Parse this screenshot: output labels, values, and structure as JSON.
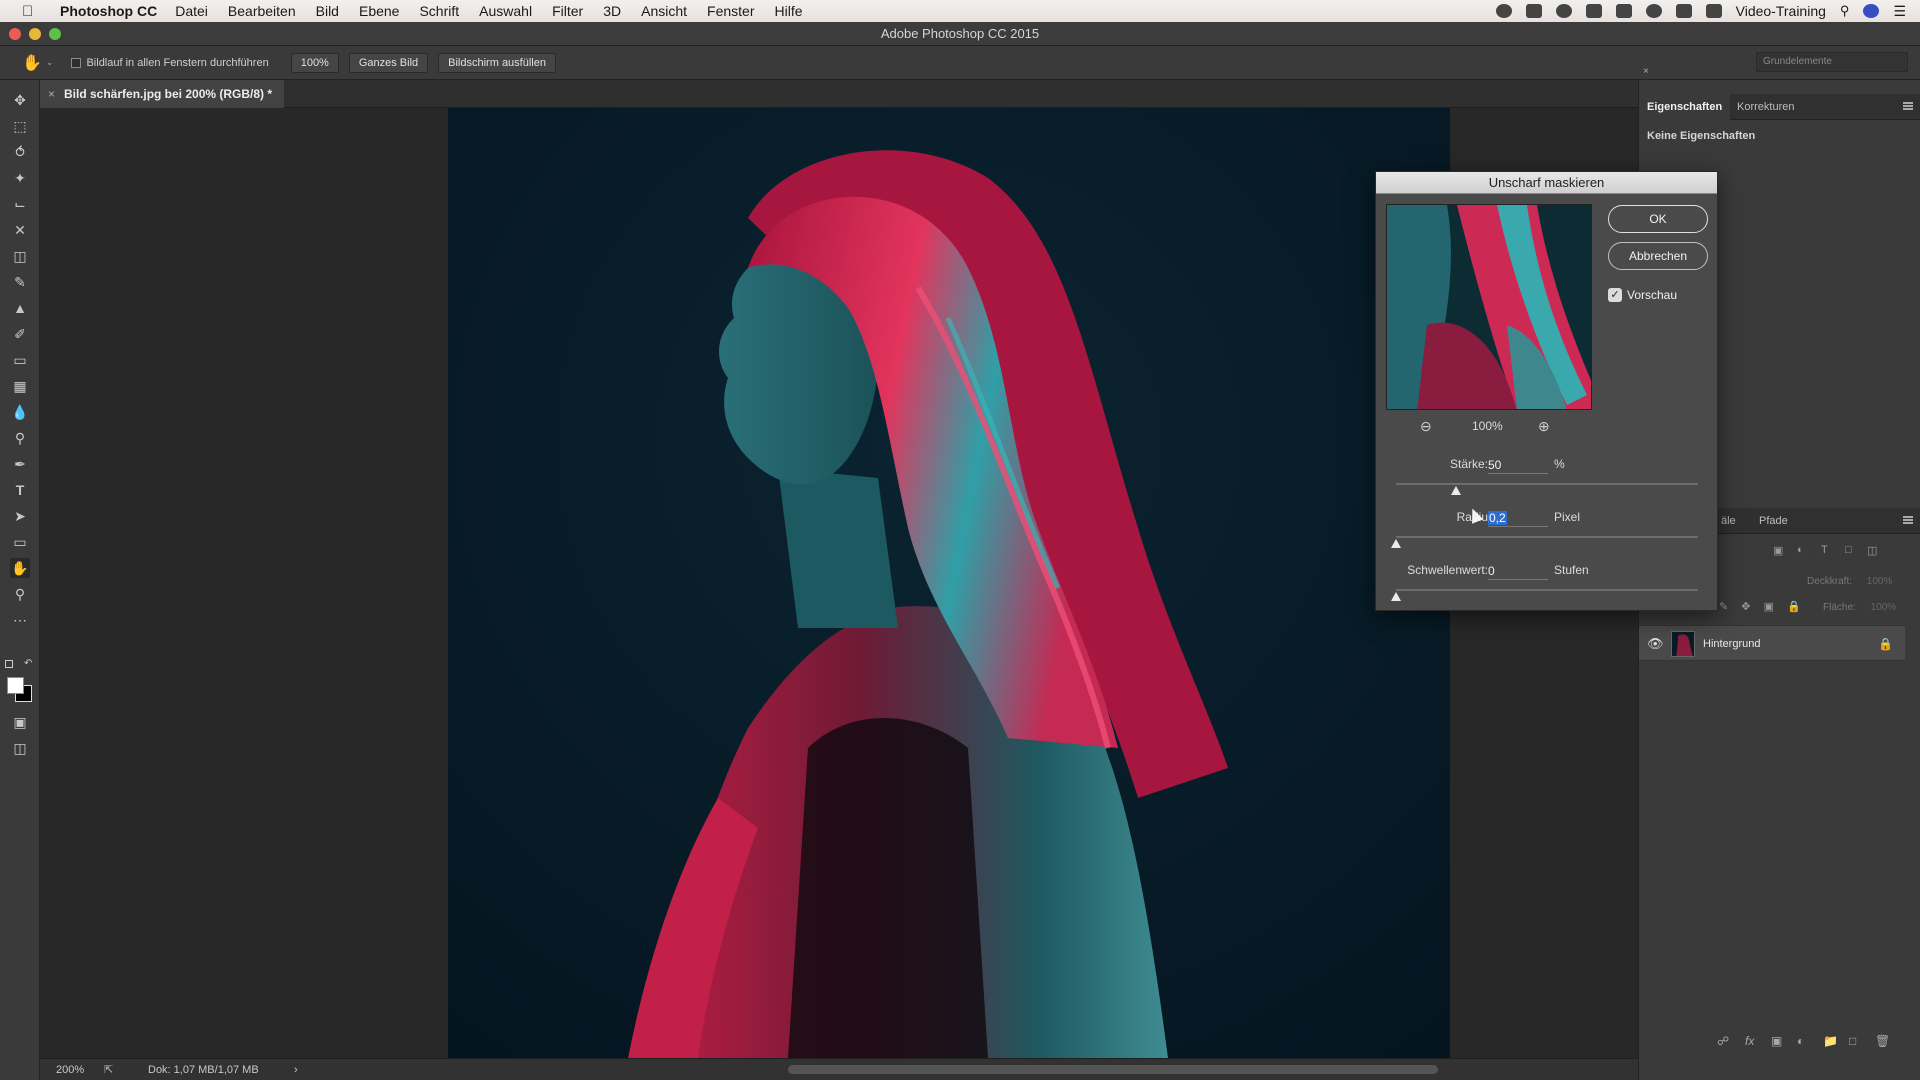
{
  "menubar": {
    "app_name": "Photoshop CC",
    "menus": [
      "Datei",
      "Bearbeiten",
      "Bild",
      "Ebene",
      "Schrift",
      "Auswahl",
      "Filter",
      "3D",
      "Ansicht",
      "Fenster",
      "Hilfe"
    ],
    "right_label": "Video-Training"
  },
  "window": {
    "title": "Adobe Photoshop CC 2015"
  },
  "options_bar": {
    "scroll_all_label": "Bildlauf in allen Fenstern durchführen",
    "zoom_100_label": "100%",
    "fit_screen_label": "Ganzes Bild",
    "fill_screen_label": "Bildschirm ausfüllen",
    "workspace_label": "Grundelemente"
  },
  "document": {
    "tab_label": "Bild schärfen.jpg bei 200% (RGB/8) *",
    "close_glyph": "×"
  },
  "status_bar": {
    "zoom": "200%",
    "doc_info": "Dok: 1,07 MB/1,07 MB",
    "arrow": "›"
  },
  "properties_panel": {
    "tabs": [
      "Eigenschaften",
      "Korrekturen"
    ],
    "active_tab": "Eigenschaften",
    "empty_text": "Keine Eigenschaften"
  },
  "layers_panel": {
    "tabs_visible": [
      "äle",
      "Pfade"
    ],
    "opacity_label": "Deckkraft:",
    "opacity_value": "100%",
    "fill_label": "Fläche:",
    "fill_value": "100%",
    "layers": [
      {
        "name": "Hintergrund",
        "locked": true,
        "visible": true
      }
    ]
  },
  "dialog": {
    "title": "Unscharf maskieren",
    "ok_label": "OK",
    "cancel_label": "Abbrechen",
    "preview_label": "Vorschau",
    "preview_checked": true,
    "preview_zoom": "100%",
    "amount": {
      "label": "Stärke:",
      "value": "50",
      "unit": "%",
      "level": 0.2
    },
    "radius": {
      "label": "Radius:",
      "label_visible": "Radiu",
      "value": "0,2",
      "unit": "Pixel",
      "level": 0.0
    },
    "threshold": {
      "label": "Schwellenwert:",
      "value": "0",
      "unit": "Stufen",
      "level": 0.0
    }
  },
  "colors": {
    "accent_highlight": "#2d6fd1",
    "pink_light": "#e2345d",
    "teal_light": "#2f9fa6"
  }
}
